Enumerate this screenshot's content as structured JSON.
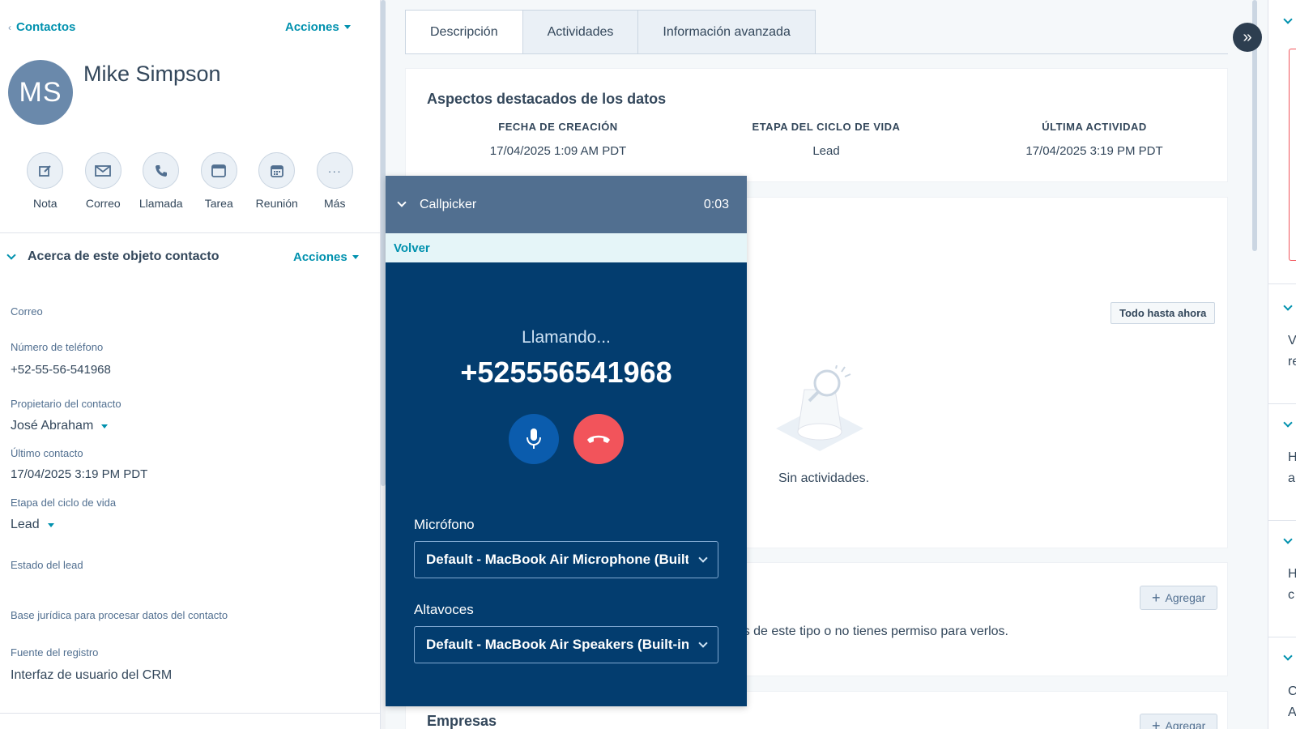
{
  "sidebar": {
    "back_label": "Contactos",
    "actions_label": "Acciones",
    "avatar_initials": "MS",
    "contact_name": "Mike Simpson",
    "quick_actions": [
      {
        "label": "Nota",
        "icon": "edit-icon"
      },
      {
        "label": "Correo",
        "icon": "email-icon"
      },
      {
        "label": "Llamada",
        "icon": "phone-icon"
      },
      {
        "label": "Tarea",
        "icon": "task-icon"
      },
      {
        "label": "Reunión",
        "icon": "calendar-icon"
      },
      {
        "label": "Más",
        "icon": "more-icon"
      }
    ],
    "about_title": "Acerca de este objeto contacto",
    "about_actions": "Acciones",
    "properties": {
      "email_label": "Correo",
      "phone_label": "Número de teléfono",
      "phone_value": "+52-55-56-541968",
      "owner_label": "Propietario del contacto",
      "owner_value": "José Abraham",
      "last_contact_label": "Último contacto",
      "last_contact_value": "17/04/2025 3:19 PM PDT",
      "lifecycle_label": "Etapa del ciclo de vida",
      "lifecycle_value": "Lead",
      "lead_status_label": "Estado del lead",
      "legal_basis_label": "Base jurídica para procesar datos del contacto",
      "source_label": "Fuente del registro",
      "source_value": "Interfaz de usuario del CRM"
    }
  },
  "main": {
    "tabs": [
      "Descripción",
      "Actividades",
      "Información avanzada"
    ],
    "highlights": {
      "title": "Aspectos destacados de los datos",
      "columns": [
        {
          "header": "FECHA DE CREACIÓN",
          "value": "17/04/2025 1:09 AM PDT"
        },
        {
          "header": "ETAPA DEL CICLO DE VIDA",
          "value": "Lead"
        },
        {
          "header": "ÚLTIMA ACTIVIDAD",
          "value": "17/04/2025 3:19 PM PDT"
        }
      ]
    },
    "activities": {
      "filter_label": "Todo hasta ahora",
      "empty_text": "Sin actividades."
    },
    "associations": {
      "add_label": "Agregar",
      "empty_text": "ados de este tipo o no tienes permiso para verlos."
    },
    "companies": {
      "title": "Empresas",
      "add_label": "Agregar"
    }
  },
  "right_sidebar": {
    "snippets": [
      "V",
      "re",
      "H",
      "a",
      "H",
      "c",
      "C",
      "A"
    ]
  },
  "callpicker": {
    "title": "Callpicker",
    "timer": "0:03",
    "back_label": "Volver",
    "status": "Llamando...",
    "number": "+525556541968",
    "mic_label": "Micrófono",
    "mic_value": "Default - MacBook Air Microphone (Built-in)",
    "speaker_label": "Altavoces",
    "speaker_value": "Default - MacBook Air Speakers (Built-in)"
  },
  "colors": {
    "accent": "#0091ae",
    "call_bg": "#033d6f",
    "hangup": "#f2545b",
    "mic": "#0b5cad"
  }
}
